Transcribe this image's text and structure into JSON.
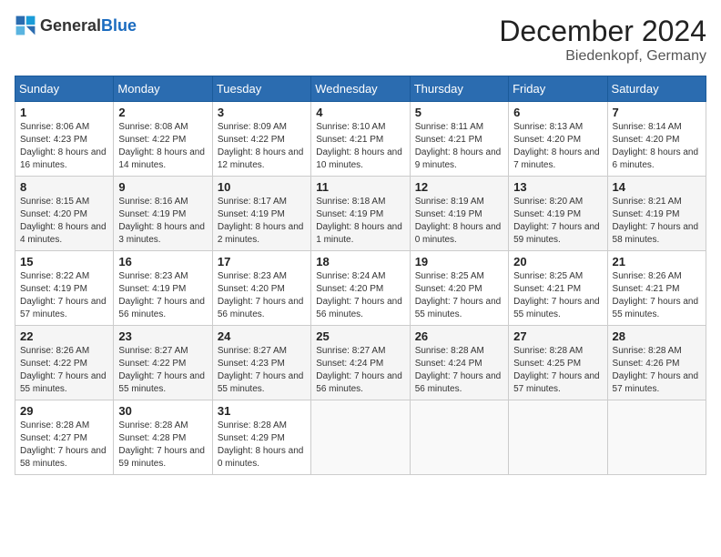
{
  "header": {
    "logo_general": "General",
    "logo_blue": "Blue",
    "month_title": "December 2024",
    "location": "Biedenkopf, Germany"
  },
  "calendar": {
    "headers": [
      "Sunday",
      "Monday",
      "Tuesday",
      "Wednesday",
      "Thursday",
      "Friday",
      "Saturday"
    ],
    "weeks": [
      [
        {
          "day": "1",
          "sunrise": "8:06 AM",
          "sunset": "4:23 PM",
          "daylight": "8 hours and 16 minutes."
        },
        {
          "day": "2",
          "sunrise": "8:08 AM",
          "sunset": "4:22 PM",
          "daylight": "8 hours and 14 minutes."
        },
        {
          "day": "3",
          "sunrise": "8:09 AM",
          "sunset": "4:22 PM",
          "daylight": "8 hours and 12 minutes."
        },
        {
          "day": "4",
          "sunrise": "8:10 AM",
          "sunset": "4:21 PM",
          "daylight": "8 hours and 10 minutes."
        },
        {
          "day": "5",
          "sunrise": "8:11 AM",
          "sunset": "4:21 PM",
          "daylight": "8 hours and 9 minutes."
        },
        {
          "day": "6",
          "sunrise": "8:13 AM",
          "sunset": "4:20 PM",
          "daylight": "8 hours and 7 minutes."
        },
        {
          "day": "7",
          "sunrise": "8:14 AM",
          "sunset": "4:20 PM",
          "daylight": "8 hours and 6 minutes."
        }
      ],
      [
        {
          "day": "8",
          "sunrise": "8:15 AM",
          "sunset": "4:20 PM",
          "daylight": "8 hours and 4 minutes."
        },
        {
          "day": "9",
          "sunrise": "8:16 AM",
          "sunset": "4:19 PM",
          "daylight": "8 hours and 3 minutes."
        },
        {
          "day": "10",
          "sunrise": "8:17 AM",
          "sunset": "4:19 PM",
          "daylight": "8 hours and 2 minutes."
        },
        {
          "day": "11",
          "sunrise": "8:18 AM",
          "sunset": "4:19 PM",
          "daylight": "8 hours and 1 minute."
        },
        {
          "day": "12",
          "sunrise": "8:19 AM",
          "sunset": "4:19 PM",
          "daylight": "8 hours and 0 minutes."
        },
        {
          "day": "13",
          "sunrise": "8:20 AM",
          "sunset": "4:19 PM",
          "daylight": "7 hours and 59 minutes."
        },
        {
          "day": "14",
          "sunrise": "8:21 AM",
          "sunset": "4:19 PM",
          "daylight": "7 hours and 58 minutes."
        }
      ],
      [
        {
          "day": "15",
          "sunrise": "8:22 AM",
          "sunset": "4:19 PM",
          "daylight": "7 hours and 57 minutes."
        },
        {
          "day": "16",
          "sunrise": "8:23 AM",
          "sunset": "4:19 PM",
          "daylight": "7 hours and 56 minutes."
        },
        {
          "day": "17",
          "sunrise": "8:23 AM",
          "sunset": "4:20 PM",
          "daylight": "7 hours and 56 minutes."
        },
        {
          "day": "18",
          "sunrise": "8:24 AM",
          "sunset": "4:20 PM",
          "daylight": "7 hours and 56 minutes."
        },
        {
          "day": "19",
          "sunrise": "8:25 AM",
          "sunset": "4:20 PM",
          "daylight": "7 hours and 55 minutes."
        },
        {
          "day": "20",
          "sunrise": "8:25 AM",
          "sunset": "4:21 PM",
          "daylight": "7 hours and 55 minutes."
        },
        {
          "day": "21",
          "sunrise": "8:26 AM",
          "sunset": "4:21 PM",
          "daylight": "7 hours and 55 minutes."
        }
      ],
      [
        {
          "day": "22",
          "sunrise": "8:26 AM",
          "sunset": "4:22 PM",
          "daylight": "7 hours and 55 minutes."
        },
        {
          "day": "23",
          "sunrise": "8:27 AM",
          "sunset": "4:22 PM",
          "daylight": "7 hours and 55 minutes."
        },
        {
          "day": "24",
          "sunrise": "8:27 AM",
          "sunset": "4:23 PM",
          "daylight": "7 hours and 55 minutes."
        },
        {
          "day": "25",
          "sunrise": "8:27 AM",
          "sunset": "4:24 PM",
          "daylight": "7 hours and 56 minutes."
        },
        {
          "day": "26",
          "sunrise": "8:28 AM",
          "sunset": "4:24 PM",
          "daylight": "7 hours and 56 minutes."
        },
        {
          "day": "27",
          "sunrise": "8:28 AM",
          "sunset": "4:25 PM",
          "daylight": "7 hours and 57 minutes."
        },
        {
          "day": "28",
          "sunrise": "8:28 AM",
          "sunset": "4:26 PM",
          "daylight": "7 hours and 57 minutes."
        }
      ],
      [
        {
          "day": "29",
          "sunrise": "8:28 AM",
          "sunset": "4:27 PM",
          "daylight": "7 hours and 58 minutes."
        },
        {
          "day": "30",
          "sunrise": "8:28 AM",
          "sunset": "4:28 PM",
          "daylight": "7 hours and 59 minutes."
        },
        {
          "day": "31",
          "sunrise": "8:28 AM",
          "sunset": "4:29 PM",
          "daylight": "8 hours and 0 minutes."
        },
        null,
        null,
        null,
        null
      ]
    ]
  }
}
